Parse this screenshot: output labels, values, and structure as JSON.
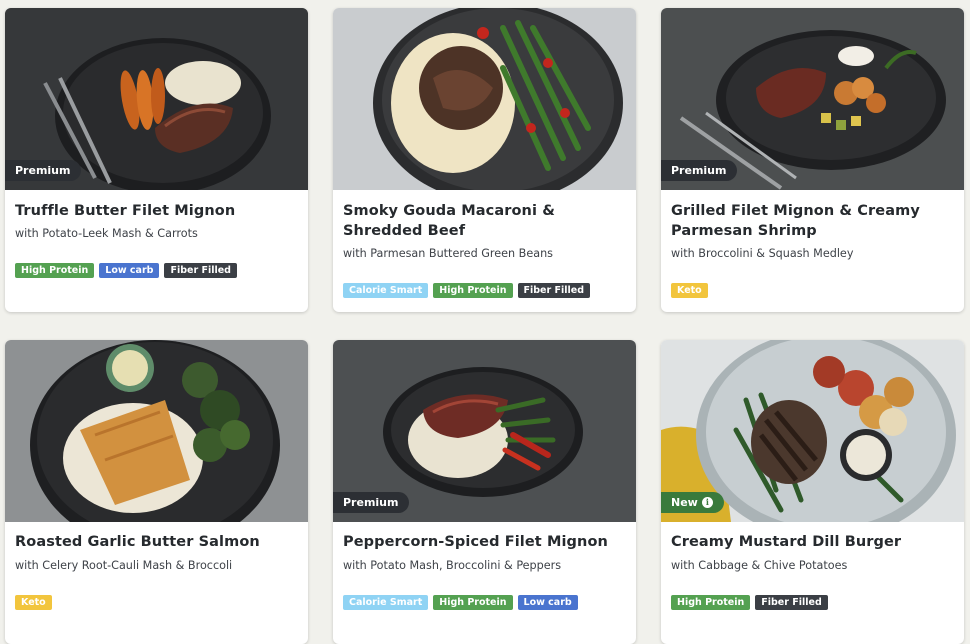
{
  "cards": [
    {
      "badge": "Premium",
      "title": "Truffle Butter Filet Mignon",
      "subtitle": "with Potato-Leek Mash & Carrots",
      "tags": [
        "High Protein",
        "Low carb",
        "Fiber Filled"
      ]
    },
    {
      "badge": "",
      "title": "Smoky Gouda Macaroni & Shredded Beef",
      "subtitle": "with Parmesan Buttered Green Beans",
      "tags": [
        "Calorie Smart",
        "High Protein",
        "Fiber Filled"
      ]
    },
    {
      "badge": "Premium",
      "title": "Grilled Filet Mignon & Creamy Parmesan Shrimp",
      "subtitle": "with Broccolini & Squash Medley",
      "tags": [
        "Keto"
      ]
    },
    {
      "badge": "",
      "title": "Roasted Garlic Butter Salmon",
      "subtitle": "with Celery Root-Cauli Mash & Broccoli",
      "tags": [
        "Keto"
      ]
    },
    {
      "badge": "Premium",
      "title": "Peppercorn-Spiced Filet Mignon",
      "subtitle": "with Potato Mash, Broccolini & Peppers",
      "tags": [
        "Calorie Smart",
        "High Protein",
        "Low carb"
      ]
    },
    {
      "badge": "New",
      "title": "Creamy Mustard Dill Burger",
      "subtitle": "with Cabbage & Chive Potatoes",
      "tags": [
        "High Protein",
        "Fiber Filled"
      ]
    }
  ],
  "icons": {
    "new_badge": "info-icon"
  },
  "colors": {
    "high_protein": "#54a151",
    "low_carb": "#4a74cf",
    "fiber_filled": "#3b3f45",
    "calorie_smart": "#8fd3f4",
    "keto": "#f2c53d",
    "premium": "#2c2f34",
    "new": "#3a7a3c"
  }
}
